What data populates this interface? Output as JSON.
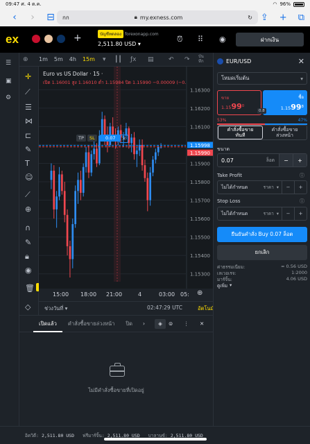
{
  "status": {
    "time": "09:47",
    "date": "ศ. 4 ต.ค.",
    "battery": "96%"
  },
  "browser": {
    "tab_text": "กก",
    "url": "my.exness.com"
  },
  "header": {
    "logo": "ex",
    "account_badge": "บัญชีทดลอง",
    "account_host": "forexonapp.com",
    "balance": "2,511.80 USD",
    "deposit_label": "ฝากเงิน"
  },
  "toolbar": {
    "timeframes": [
      "1m",
      "5m",
      "4h",
      "15m"
    ],
    "active_timeframe": "15m",
    "publish_label": "บัน\nทึก"
  },
  "chart": {
    "legend_title": "Euro vs US Dollar · 15 ·",
    "ohlc": "เปิด 1.16001 สูง 1.16010 ต่ำ 1.15984 ปิด 1.15990 −0.00009 (−0.",
    "price_labels": [
      "1.16300",
      "1.16200",
      "1.16100",
      "1.16000",
      "1.15900",
      "1.15800",
      "1.15700",
      "1.15600",
      "1.15500",
      "1.15400",
      "1.15300"
    ],
    "current_ask": "1.15998",
    "current_bid": "1.15990",
    "time_labels": [
      "15:00",
      "18:00",
      "21:00",
      "4",
      "03:00",
      "05:"
    ],
    "tp_label": "TP",
    "sl_label": "SL",
    "order_volume": "0.07",
    "range_label": "ช่วงวันที่",
    "clock": "02:47:29 UTC",
    "auto_label": "อัตโนมัติ"
  },
  "orders": {
    "tabs": [
      "เปิดแล้ว",
      "คำสั่งซื้อขายล่วงหน้า",
      "ปิด"
    ],
    "empty_text": "ไม่มีคำสั่งซื้อขายที่เปิดอยู่"
  },
  "panel": {
    "symbol": "EUR/USD",
    "mode": "โหมดเริ่มต้น",
    "sell_label": "ขาย",
    "sell_price_main": "1.15",
    "sell_price_big": "99",
    "sell_price_sup": "0",
    "buy_label": "ซื้อ",
    "buy_price_main": "1.15",
    "buy_price_big": "99",
    "buy_price_sup": "8",
    "spread": "0.8",
    "sell_pct": "53%",
    "buy_pct": "47%",
    "sell_share": 0.53,
    "order_tabs": [
      "คำสั่งซื้อขาย\nทันที",
      "คำสั่งซื้อขาย\nล่วงหน้า"
    ],
    "volume_label": "ขนาด",
    "volume": "0.07",
    "volume_unit": "ล็อต",
    "tp_label": "Take Profit",
    "sl_label": "Stop Loss",
    "not_set": "ไม่ได้กำหนด",
    "price_unit": "ราคา",
    "confirm": "ยืนยันคำสั่ง Buy 0.07 ล็อต",
    "cancel": "ยกเลิก",
    "fee_label": "ค่าธรรมเนียม:",
    "fee_value": "≈ 0.56 USD",
    "leverage_label": "เลเวอเรจ:",
    "leverage_value": "1:2000",
    "margin_label": "มาร์จิ้น:",
    "margin_value": "4.06 USD",
    "more_label": "ดูเพิ่ม"
  },
  "footer": {
    "equity_label": "อิควิตี:",
    "equity": "2,511.80 USD",
    "free_margin_label": "ฟรีมาร์จิ้น:",
    "free_margin": "2,511.80 USD",
    "balance_label": "บาลานซ์:",
    "balance": "2,511.80 USD"
  },
  "colors": {
    "up": "#2e8cf0",
    "down": "#f0474f",
    "accent": "#ffde02",
    "buy": "#158bf9"
  },
  "chart_data": {
    "type": "candlestick",
    "title": "Euro vs US Dollar · 15",
    "ylim": [
      1.1525,
      1.1635
    ],
    "ohlc_series": [
      [
        1.1581,
        1.159,
        1.1576,
        1.1586
      ],
      [
        1.1586,
        1.1589,
        1.156,
        1.1565
      ],
      [
        1.1565,
        1.1575,
        1.1555,
        1.1572
      ],
      [
        1.1572,
        1.1588,
        1.157,
        1.1584
      ],
      [
        1.1584,
        1.1586,
        1.1573,
        1.1575
      ],
      [
        1.1575,
        1.158,
        1.1558,
        1.1562
      ],
      [
        1.1562,
        1.1565,
        1.154,
        1.1545
      ],
      [
        1.1545,
        1.1548,
        1.1528,
        1.1538
      ],
      [
        1.1538,
        1.156,
        1.1533,
        1.1557
      ],
      [
        1.1557,
        1.1578,
        1.1555,
        1.1575
      ],
      [
        1.1575,
        1.1585,
        1.1568,
        1.1581
      ],
      [
        1.1581,
        1.1586,
        1.157,
        1.1574
      ],
      [
        1.1574,
        1.159,
        1.1572,
        1.1588
      ],
      [
        1.1588,
        1.1599,
        1.1585,
        1.1596
      ],
      [
        1.1596,
        1.16,
        1.1582,
        1.1585
      ],
      [
        1.1585,
        1.1597,
        1.1583,
        1.1595
      ],
      [
        1.1595,
        1.1602,
        1.1592,
        1.1598
      ],
      [
        1.1598,
        1.1601,
        1.1588,
        1.159
      ],
      [
        1.159,
        1.1608,
        1.1589,
        1.1605
      ],
      [
        1.1605,
        1.1618,
        1.1602,
        1.1614
      ],
      [
        1.1614,
        1.1616,
        1.16,
        1.1604
      ],
      [
        1.1604,
        1.161,
        1.1596,
        1.16
      ],
      [
        1.16,
        1.1612,
        1.1599,
        1.161
      ],
      [
        1.161,
        1.1615,
        1.1602,
        1.1605
      ],
      [
        1.1605,
        1.1609,
        1.1598,
        1.1603
      ],
      [
        1.1603,
        1.161,
        1.16,
        1.1608
      ],
      [
        1.1608,
        1.1611,
        1.1601,
        1.1604
      ],
      [
        1.1604,
        1.1607,
        1.1599,
        1.1605
      ],
      [
        1.1605,
        1.1612,
        1.1603,
        1.1609
      ],
      [
        1.1609,
        1.161,
        1.1598,
        1.1601
      ],
      [
        1.1601,
        1.1606,
        1.1596,
        1.1604
      ],
      [
        1.1604,
        1.1607,
        1.1592,
        1.1595
      ],
      [
        1.1595,
        1.1599,
        1.1588,
        1.1597
      ],
      [
        1.1597,
        1.1603,
        1.1594,
        1.16
      ],
      [
        1.16,
        1.1603,
        1.1586,
        1.1589
      ],
      [
        1.1589,
        1.1592,
        1.158,
        1.1582
      ],
      [
        1.1582,
        1.1585,
        1.1564,
        1.157
      ],
      [
        1.157,
        1.1588,
        1.1567,
        1.1585
      ],
      [
        1.1585,
        1.1594,
        1.1583,
        1.1592
      ],
      [
        1.1592,
        1.1598,
        1.159,
        1.1596
      ],
      [
        1.1596,
        1.16,
        1.1594,
        1.1599
      ],
      [
        1.1599,
        1.1601,
        1.1598,
        1.1599
      ]
    ]
  }
}
